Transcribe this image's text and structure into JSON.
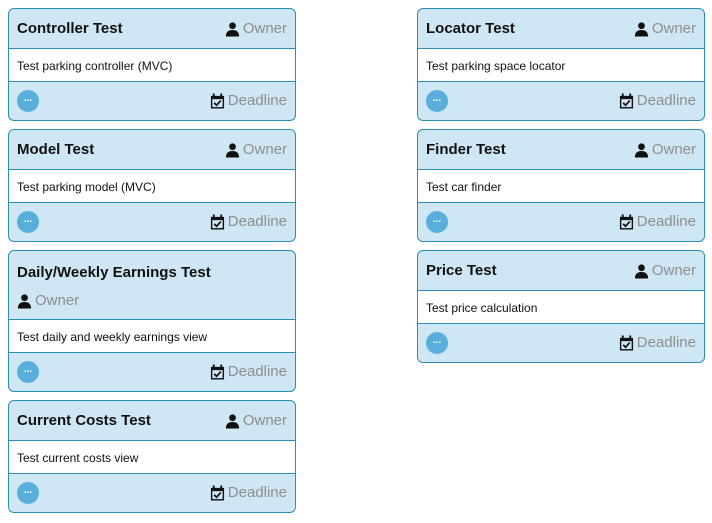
{
  "labels": {
    "owner": "Owner",
    "deadline": "Deadline",
    "more": "..."
  },
  "icons": {
    "owner": "person-icon",
    "deadline": "calendar-check-icon"
  },
  "colors": {
    "card_header_bg": "#cfe6f5",
    "card_border": "#2b8fb3",
    "more_button": "#5aaedc",
    "placeholder_text": "#8e8e8e"
  },
  "columns": [
    {
      "cards": [
        {
          "title": "Controller Test",
          "description": "Test parking controller (MVC)"
        },
        {
          "title": "Model Test",
          "description": "Test parking model (MVC)"
        },
        {
          "title": "Daily/Weekly Earnings Test",
          "description": "Test daily and weekly earnings view"
        },
        {
          "title": "Current Costs Test",
          "description": "Test current costs view"
        }
      ]
    },
    {
      "cards": [
        {
          "title": "Locator Test",
          "description": "Test parking space locator"
        },
        {
          "title": "Finder Test",
          "description": "Test car finder"
        },
        {
          "title": "Price Test",
          "description": "Test price calculation"
        }
      ]
    }
  ]
}
